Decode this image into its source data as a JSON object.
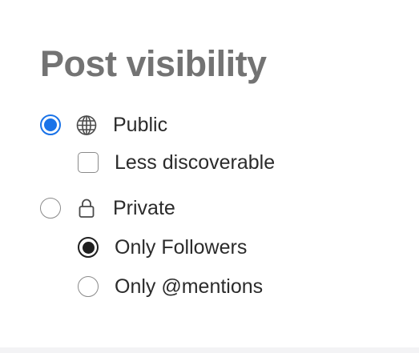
{
  "page": {
    "title": "Post visibility"
  },
  "options": {
    "public": {
      "label": "Public",
      "icon": "globe-icon",
      "selected": true,
      "accent_color": "#1a73e8"
    },
    "less_discoverable": {
      "label": "Less discoverable",
      "checked": false
    },
    "private": {
      "label": "Private",
      "icon": "lock-icon",
      "selected": false
    },
    "only_followers": {
      "label": "Only Followers",
      "selected": true
    },
    "only_mentions": {
      "label": "Only @mentions",
      "selected": false
    }
  }
}
